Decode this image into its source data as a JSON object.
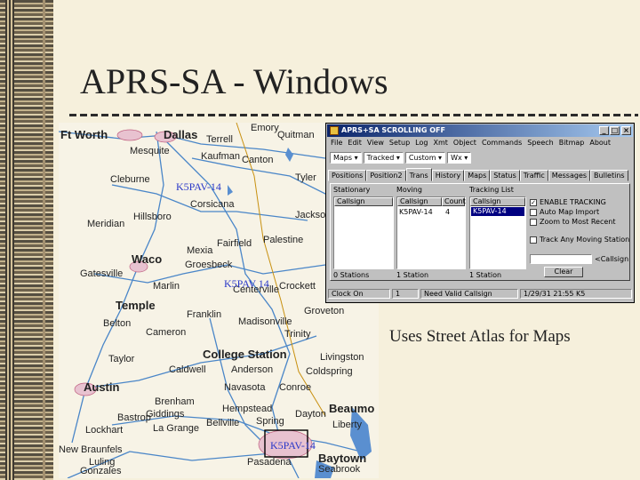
{
  "slide": {
    "title": "APRS-SA - Windows",
    "caption": "Uses Street Atlas for Maps"
  },
  "map": {
    "cities_large": [
      "Ft Worth",
      "Dallas",
      "Waco",
      "Temple",
      "College Station",
      "Austin",
      "Beaumo",
      "Baytown"
    ],
    "cities_small": [
      "Terrell",
      "Mesquite",
      "Kaufman",
      "Canton",
      "Cleburne",
      "Tyler",
      "Corsicana",
      "Hillsboro",
      "Meridian",
      "Fairfield",
      "Palestine",
      "Gatesville",
      "Groesbeck",
      "Marlin",
      "Centerville",
      "Crockett",
      "Belton",
      "Franklin",
      "Madisonville",
      "Groveton",
      "Cameron",
      "Taylor",
      "Caldwell",
      "Anderson",
      "Livingston",
      "Coldspring",
      "Navasota",
      "Conroe",
      "Giddings",
      "Hempstead",
      "Dayton",
      "Liberty",
      "Bellville",
      "La Grange",
      "Bastrop",
      "Lockhart",
      "Pasadena",
      "Seabrook",
      "Gonzales",
      "Emory",
      "Quitman",
      "Trinity",
      "Jackso",
      "Brenham",
      "Spring",
      "New Braunfels",
      "Luling",
      "Mexia"
    ],
    "callsigns": [
      "K5PAV-14",
      "K5PAV 14"
    ],
    "callsign_color": "#2a38c8"
  },
  "app": {
    "window_title": "APRS+SA SCROLLING OFF",
    "menu": [
      "File",
      "Edit",
      "View",
      "Setup",
      "Log",
      "Xmt",
      "Object",
      "Commands",
      "Speech",
      "Bitmap",
      "About"
    ],
    "toolbar": {
      "maps": "Maps",
      "tracked": "Tracked",
      "custom": "Custom",
      "wx": "Wx"
    },
    "tabs": [
      "Positions",
      "Position2",
      "Trans",
      "History",
      "Maps",
      "Status",
      "Traffic",
      "Messages",
      "Bulletins"
    ],
    "stationary": {
      "label": "Stationary",
      "col_callsign": "Callsign"
    },
    "moving": {
      "label": "Moving",
      "col_callsign": "Callsign",
      "col_count": "Count",
      "row_callsign": "K5PAV-14",
      "row_count": "4"
    },
    "tracking": {
      "label": "Tracking List",
      "col_callsign": "Callsign",
      "row_callsign": "K5PAV-14"
    },
    "options": {
      "enable_tracking": "ENABLE TRACKING",
      "auto_map_import": "Auto Map Import",
      "zoom_to_most_recent": "Zoom to Most Recent",
      "track_any_moving": "Track Any Moving Station"
    },
    "callsign_btn": "<Callsign",
    "clear_btn": "Clear",
    "counts": {
      "stations": "0 Stations",
      "moving": "1 Station",
      "tracking": "1 Station"
    },
    "status": {
      "clock": "Clock On",
      "num": "1",
      "valid": "Need Valid Callsign",
      "time": "1/29/31 21:55 K5"
    }
  }
}
